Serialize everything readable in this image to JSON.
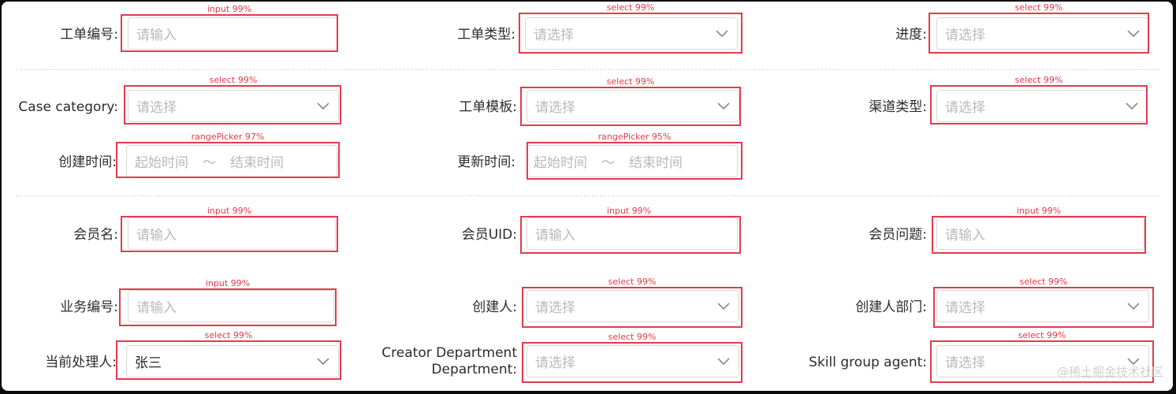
{
  "fields": {
    "work_order_no": {
      "label": "工单编号:",
      "placeholder": "请输入",
      "tag": "input 99%"
    },
    "work_order_type": {
      "label": "工单类型:",
      "placeholder": "请选择",
      "tag": "select 99%"
    },
    "progress": {
      "label": "进度:",
      "placeholder": "请选择",
      "tag": "select 99%"
    },
    "case_category": {
      "label": "Case category:",
      "placeholder": "请选择",
      "tag": "select 99%"
    },
    "work_order_template": {
      "label": "工单模板:",
      "placeholder": "请选择",
      "tag": "select 99%"
    },
    "channel_type": {
      "label": "渠道类型:",
      "placeholder": "请选择",
      "tag": "select 99%"
    },
    "created_time": {
      "label": "创建时间:",
      "start": "起始时间",
      "sep": "～",
      "end": "结束时间",
      "tag": "rangePicker 97%"
    },
    "updated_time": {
      "label": "更新时间:",
      "start": "起始时间",
      "sep": "～",
      "end": "结束时间",
      "tag": "rangePicker 95%"
    },
    "member_name": {
      "label": "会员名:",
      "placeholder": "请输入",
      "tag": "input 99%"
    },
    "member_uid": {
      "label": "会员UID:",
      "placeholder": "请输入",
      "tag": "input 99%"
    },
    "member_issue": {
      "label": "会员问题:",
      "placeholder": "请输入",
      "tag": "input 99%"
    },
    "business_no": {
      "label": "业务编号:",
      "placeholder": "请输入",
      "tag": "input 99%"
    },
    "creator": {
      "label": "创建人:",
      "placeholder": "请选择",
      "tag": "select 99%"
    },
    "creator_department": {
      "label": "创建人部门:",
      "placeholder": "请选择",
      "tag": "select 99%"
    },
    "current_handler": {
      "label": "当前处理人:",
      "value": "张三",
      "tag": "select 99%"
    },
    "creator_department_en": {
      "label": "Creator Department Department:",
      "placeholder": "请选择",
      "tag": "select 99%"
    },
    "skill_group_agent": {
      "label": "Skill group agent:",
      "placeholder": "请选择",
      "tag": "select 99%"
    }
  },
  "watermark": "@稀土掘金技术社区",
  "colors": {
    "annotation": "#e23b4d",
    "border": "#d9d9d9",
    "placeholder": "#b9b9b9",
    "text": "#2b2b2b"
  }
}
